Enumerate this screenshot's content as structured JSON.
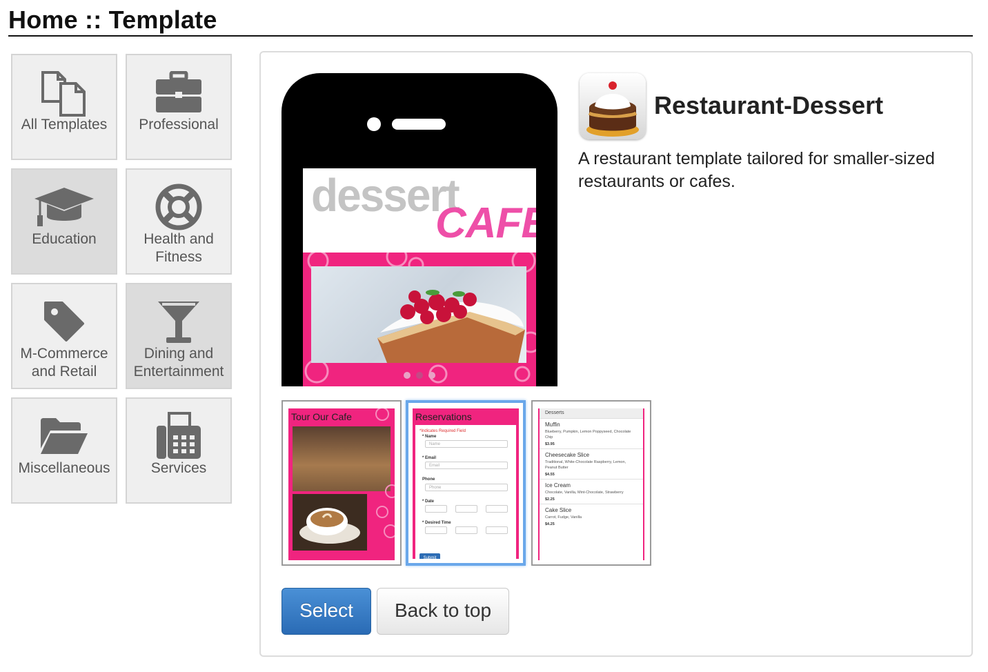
{
  "header": {
    "breadcrumb": "Home :: Template"
  },
  "categories": [
    {
      "label": "All Templates",
      "icon": "copy-icon"
    },
    {
      "label": "Professional",
      "icon": "briefcase-icon"
    },
    {
      "label": "Education",
      "icon": "graduation-cap-icon"
    },
    {
      "label": "Health and Fitness",
      "icon": "lifebuoy-icon"
    },
    {
      "label": "M-Commerce and Retail",
      "icon": "tag-icon"
    },
    {
      "label": "Dining and Entertainment",
      "icon": "cocktail-glass-icon"
    },
    {
      "label": "Miscellaneous",
      "icon": "folder-open-icon"
    },
    {
      "label": "Services",
      "icon": "fax-icon"
    }
  ],
  "template": {
    "name": "Restaurant-Dessert",
    "description": "A restaurant template tailored for smaller-sized restaurants or cafes.",
    "preview": {
      "word1": "dessert",
      "word2": "CAFE"
    },
    "thumbnails": [
      {
        "title": "Tour Our Cafe"
      },
      {
        "title": "Reservations",
        "required_note": "*Indicates Required Field",
        "fields": [
          {
            "label": "* Name",
            "placeholder": "Name"
          },
          {
            "label": "* Email",
            "placeholder": "Email"
          },
          {
            "label": "Phone",
            "placeholder": "Phone"
          }
        ],
        "date_label": "* Date",
        "time_label": "* Desired Time",
        "submit": "Submit"
      },
      {
        "title": "Desserts",
        "items": [
          {
            "name": "Muffin",
            "desc": "Blueberry, Pumpkin, Lemon Poppyseed, Chocolate Chip",
            "price": "$3.95"
          },
          {
            "name": "Cheesecake Slice",
            "desc": "Traditional, White-Chocolate Raspberry, Lemon, Peanut Butter",
            "price": "$4.55"
          },
          {
            "name": "Ice Cream",
            "desc": "Chocolate, Vanilla, Mint-Chocolate, Strawberry",
            "price": "$2.25"
          },
          {
            "name": "Cake Slice",
            "desc": "Carrot, Fudge, Vanilla",
            "price": "$4.25"
          }
        ]
      }
    ]
  },
  "actions": {
    "select": "Select",
    "back_to_top": "Back to top"
  },
  "colors": {
    "accent_blue": "#2a6bb5",
    "brand_pink": "#f0247f",
    "tile_bg": "#efefef"
  }
}
